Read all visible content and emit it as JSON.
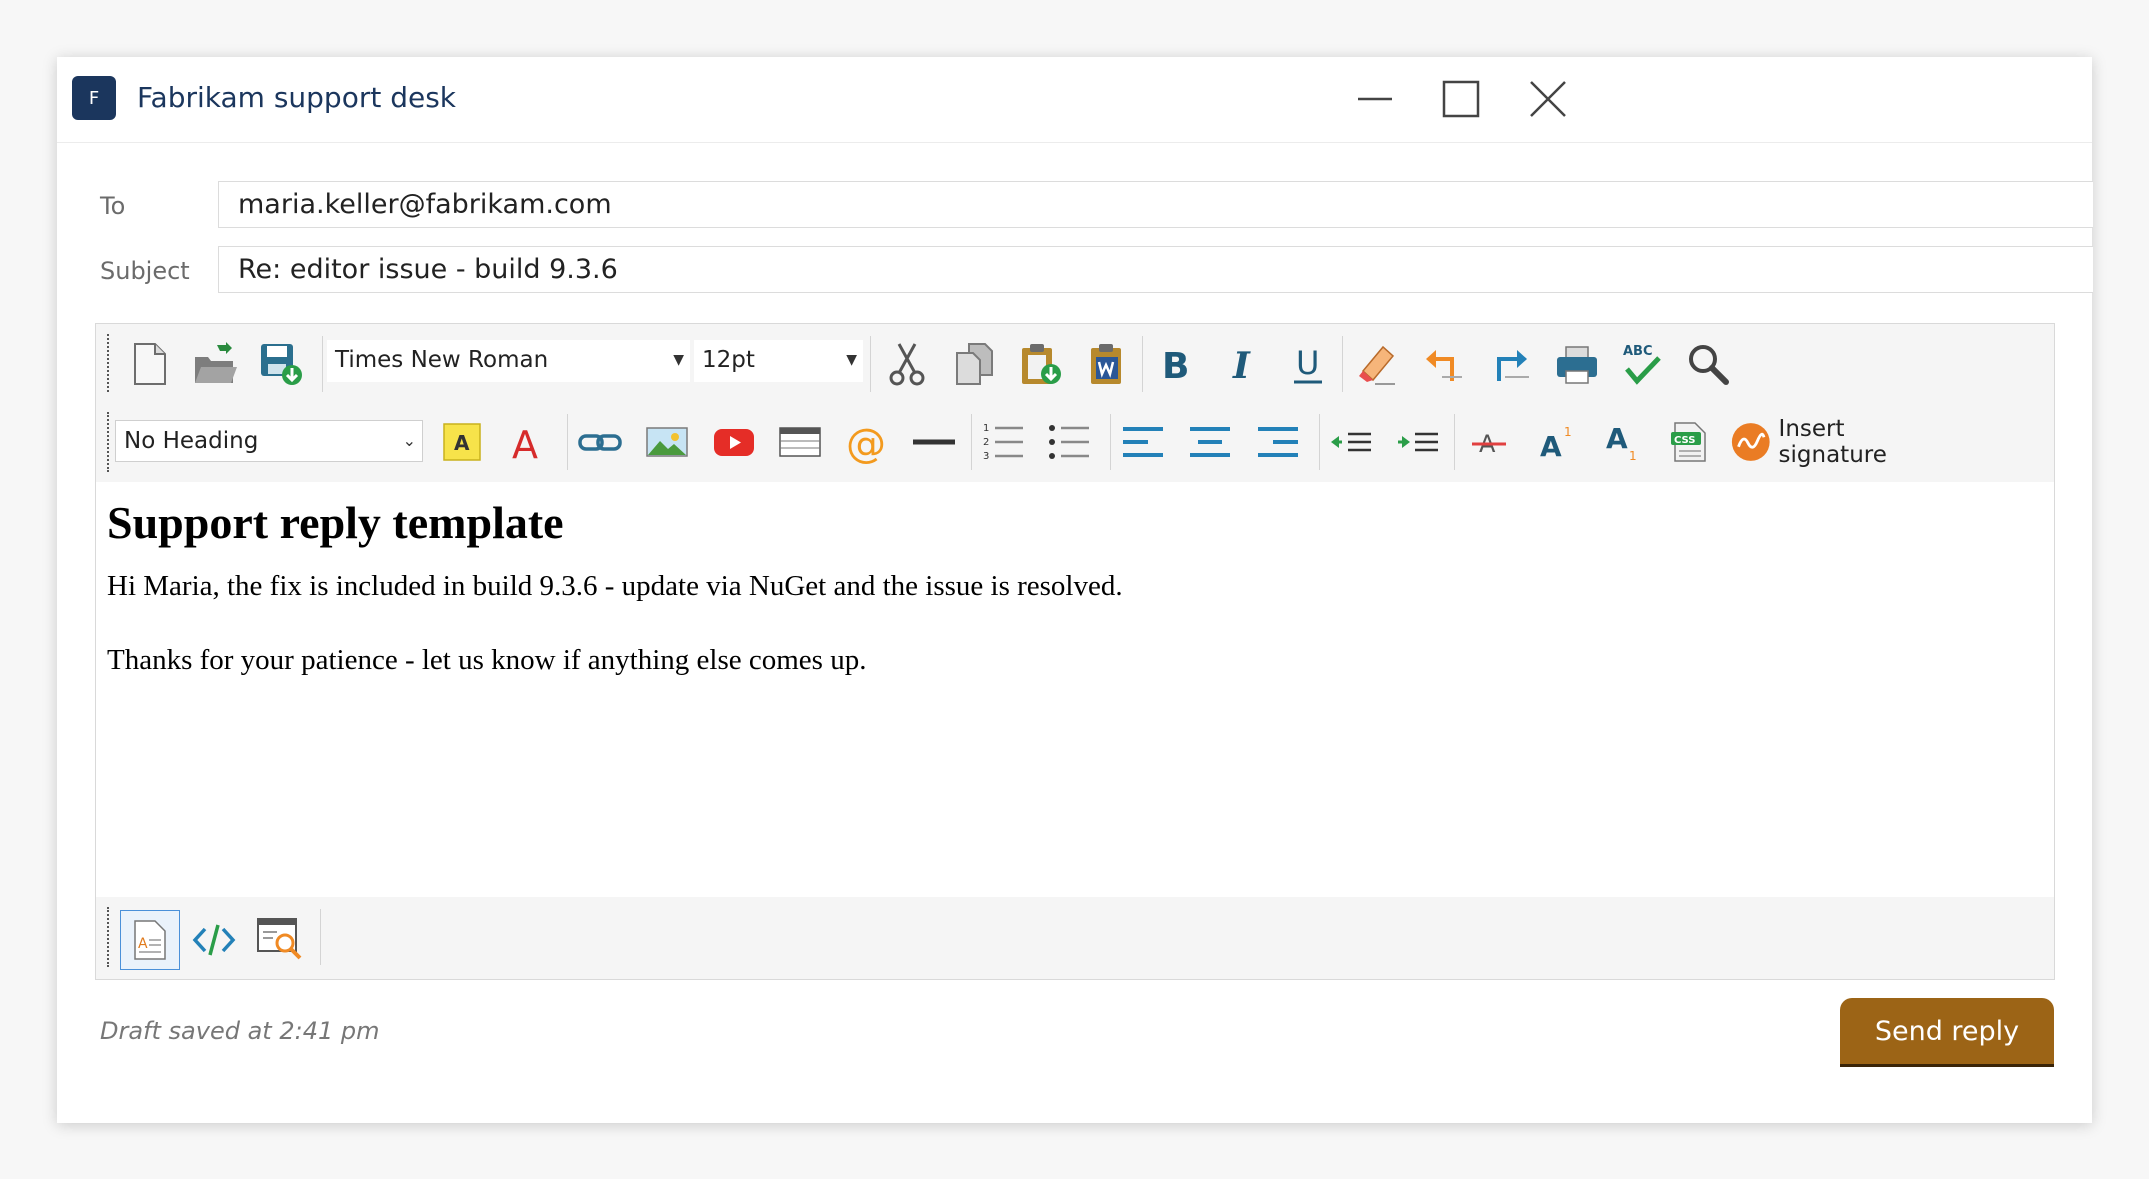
{
  "window": {
    "logo_letter": "F",
    "title": "Fabrikam support desk",
    "controls": [
      "minimize-icon",
      "maximize-icon",
      "close-icon"
    ]
  },
  "fields": {
    "to_label": "To",
    "to_value": "maria.keller@fabrikam.com",
    "subject_label": "Subject",
    "subject_value": "Re: editor issue - build 9.3.6"
  },
  "toolbar1": {
    "font_family": "Times New Roman",
    "font_size": "12pt",
    "buttons": [
      "new-document-icon",
      "open-folder-icon",
      "save-icon",
      "cut-icon",
      "copy-icon",
      "paste-icon",
      "paste-from-word-icon",
      "bold-icon",
      "italic-icon",
      "underline-icon",
      "clear-formatting-icon",
      "undo-icon",
      "redo-icon",
      "print-icon",
      "spellcheck-icon",
      "find-icon"
    ]
  },
  "toolbar2": {
    "heading": "No Heading",
    "insert_signature_label": "Insert signature",
    "highlight_letter": "A",
    "fontcolor_letter": "A",
    "strikethrough_letter": "A",
    "superscript_letter": "A",
    "superscript_mark": "1",
    "subscript_letter": "A",
    "subscript_mark": "1",
    "css_label": "CSS",
    "numbered_marks": [
      "1",
      "2",
      "3"
    ],
    "buttons": [
      "highlight-icon",
      "font-color-icon",
      "link-icon",
      "image-icon",
      "youtube-icon",
      "table-icon",
      "email-link-icon",
      "horizontal-rule-icon",
      "numbered-list-icon",
      "bullet-list-icon",
      "align-left-icon",
      "align-center-icon",
      "align-right-icon",
      "outdent-icon",
      "indent-icon",
      "strikethrough-icon",
      "superscript-icon",
      "subscript-icon",
      "css-icon",
      "signature-icon"
    ]
  },
  "content": {
    "heading": "Support reply template",
    "paragraphs": [
      "Hi Maria, the fix is included in build 9.3.6 - update via NuGet and the issue is resolved.",
      "Thanks for your patience - let us know if anything else comes up."
    ]
  },
  "view_tabs": {
    "design_letter": "A",
    "items": [
      "design-view-icon",
      "html-view-icon",
      "preview-icon"
    ],
    "active": "design-view-icon"
  },
  "footer": {
    "status": "Draft saved at 2:41 pm",
    "send_label": "Send reply"
  },
  "colors": {
    "brand": "#1b365d",
    "send_button": "#9c6416",
    "icon_blue": "#1f6e9c",
    "icon_orange": "#f39c12"
  }
}
